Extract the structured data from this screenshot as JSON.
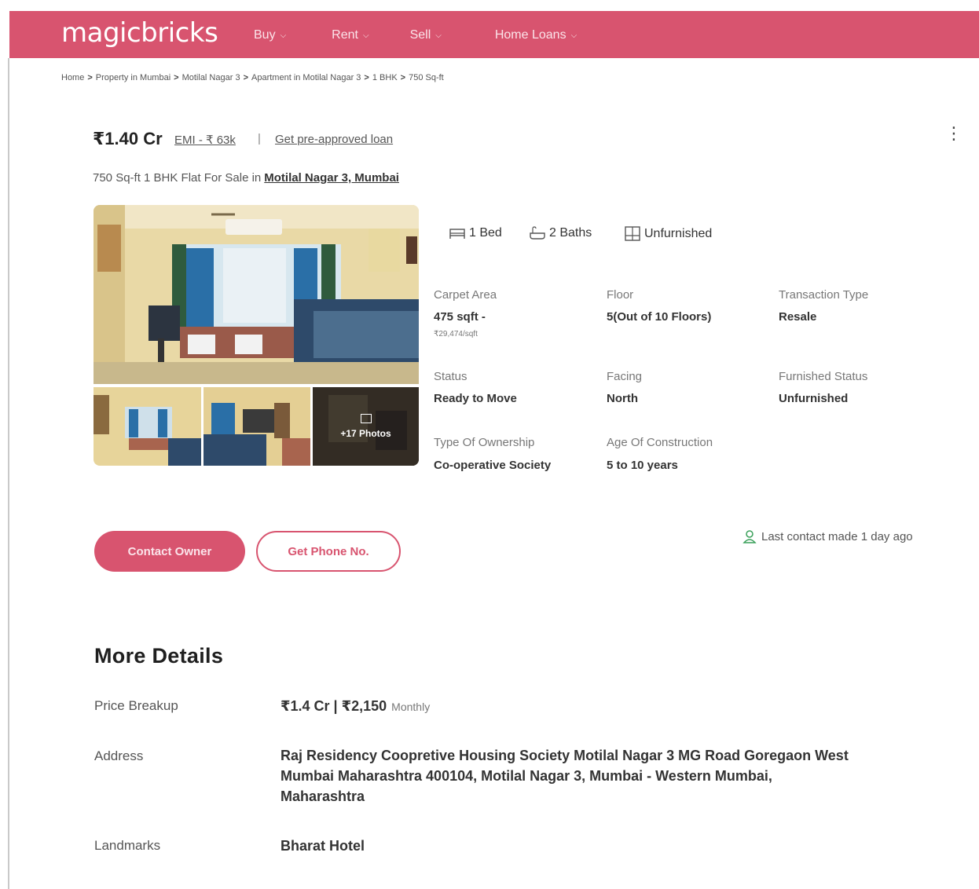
{
  "brand": {
    "name": "magicbricks",
    "color": "#d8546f"
  },
  "nav": [
    {
      "label": "Buy"
    },
    {
      "label": "Rent"
    },
    {
      "label": "Sell"
    },
    {
      "label": "Home Loans"
    }
  ],
  "breadcrumb": [
    "Home",
    "Property in Mumbai",
    "Motilal Nagar 3",
    "Apartment in Motilal Nagar 3",
    "1 BHK",
    "750 Sq-ft"
  ],
  "breadcrumb_sep": ">",
  "listing": {
    "price": "₹1.40 Cr",
    "emi": "EMI - ₹ 63k",
    "pipe": "|",
    "preapproved": "Get pre-approved loan",
    "title_prefix": "750 Sq-ft 1 BHK Flat For Sale in",
    "location": "Motilal Nagar 3, Mumbai",
    "photos_count": "+17 Photos"
  },
  "amenities": {
    "bed": "1 Bed",
    "bath": "2 Baths",
    "furnish": "Unfurnished"
  },
  "details": {
    "carpet_area_label": "Carpet Area",
    "carpet_area_value": "475 sqft -",
    "carpet_area_rate": "₹29,474/sqft",
    "floor_label": "Floor",
    "floor_value": "5(Out of 10 Floors)",
    "transaction_label": "Transaction Type",
    "transaction_value": "Resale",
    "status_label": "Status",
    "status_value": "Ready to Move",
    "facing_label": "Facing",
    "facing_value": "North",
    "furnished_label": "Furnished Status",
    "furnished_value": "Unfurnished",
    "ownership_label": "Type Of Ownership",
    "ownership_value": "Co-operative Society",
    "age_label": "Age Of Construction",
    "age_value": "5 to 10 years"
  },
  "actions": {
    "contact_owner": "Contact Owner",
    "get_phone": "Get Phone No.",
    "last_contact": "Last contact made 1 day ago"
  },
  "more_details": {
    "title": "More Details",
    "price_breakup_label": "Price Breakup",
    "price_breakup_value": "₹1.4 Cr | ₹2,150",
    "price_breakup_suffix": "Monthly",
    "address_label": "Address",
    "address_line1": "Raj Residency Coopretive Housing Society Motilal Nagar 3 MG Road Goregaon West",
    "address_line2": "Mumbai Maharashtra 400104, Motilal Nagar 3, Mumbai - Western Mumbai,",
    "address_line3": "Maharashtra",
    "landmarks_label": "Landmarks",
    "landmarks_value": "Bharat Hotel"
  }
}
